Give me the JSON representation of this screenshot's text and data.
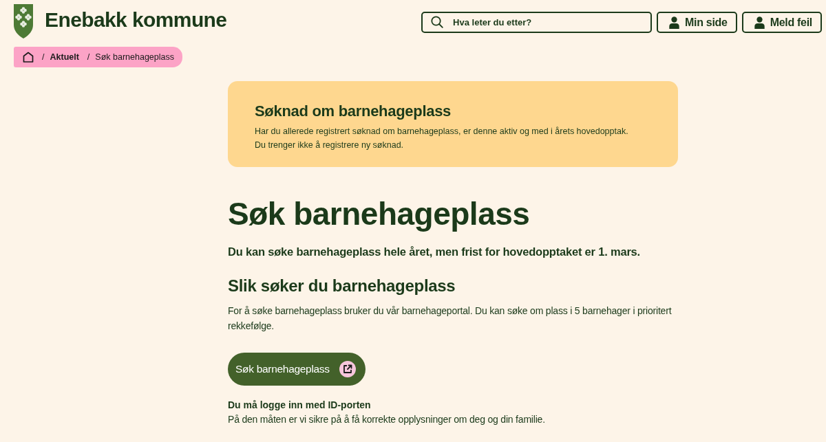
{
  "header": {
    "site_name": "Enebakk kommune",
    "search": {
      "placeholder": "Hva leter du etter?"
    },
    "buttons": [
      {
        "label": "Min side"
      },
      {
        "label": "Meld feil"
      }
    ]
  },
  "breadcrumb": [
    {
      "separator": "/",
      "label": "Aktuelt",
      "current": false
    },
    {
      "separator": "/",
      "label": "Søk barnehageplass",
      "current": true
    }
  ],
  "notice": {
    "title": "Søknad om barnehageplass",
    "lines": [
      "Har du allerede registrert søknad om barnehageplass, er denne aktiv og med i årets hovedopptak.",
      "Du trenger ikke å registrere ny søknad."
    ]
  },
  "article": {
    "title": "Søk barnehageplass",
    "lead": "Du kan søke barnehageplass hele året, men frist for hovedopptaket er 1. mars.",
    "section_title": "Slik søker du barnehageplass",
    "paragraph": "For å søke barnehageplass bruker du vår barnehageportal. Du kan søke om plass i 5 barnehager i prioritert rekkefølge.",
    "cta": {
      "label": "Søk barnehageplass"
    },
    "note_title": "Du må logge inn med ID-porten",
    "note_text": "På den måten er vi sikre på å få korrekte opplysninger om deg og din familie."
  }
}
